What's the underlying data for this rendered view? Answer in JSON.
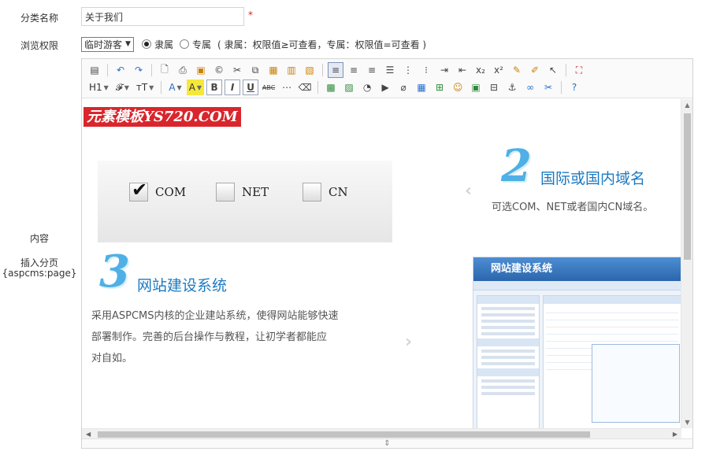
{
  "form": {
    "category_label": "分类名称",
    "category_value": "关于我们",
    "required_mark": "*",
    "permission_label": "浏览权限",
    "permission_select": "临时游客",
    "permission_options": [
      {
        "label": "隶属",
        "selected": true
      },
      {
        "label": "专属",
        "selected": false
      }
    ],
    "permission_note": "( 隶属：权限值≥可查看，专属：权限值=可查看 )",
    "content_label": "内容",
    "insert_page_label": "插入分页",
    "insert_page_code": "{aspcms:page}"
  },
  "toolbar": {
    "heading_label": "H1",
    "font_label": "𝓕",
    "size_label": "тT",
    "font_color_label": "A",
    "bg_color_label": "A",
    "bold": "B",
    "italic": "I",
    "underline": "U",
    "strike": "ABC",
    "subscript": "x₂",
    "superscript": "x²",
    "help": "?"
  },
  "content": {
    "brand_text": "元素模板YS720.COM",
    "domains": [
      "COM",
      "NET",
      "CN"
    ],
    "feature2": {
      "number": "2",
      "title": "国际或国内域名",
      "desc": "可选COM、NET或者国内CN域名。"
    },
    "feature3": {
      "number": "3",
      "title": "网站建设系统",
      "desc_lines": [
        "采用ASPCMS内核的企业建站系统，使得网站能够快速",
        "部署制作。完善的后台操作与教程，让初学者都能应",
        "对自如。"
      ]
    },
    "mock_title": "网站建设系统"
  },
  "colors": {
    "brand_red": "#d8262c",
    "accent_blue": "#1c7ac2",
    "number_blue": "#4fb0e6"
  }
}
